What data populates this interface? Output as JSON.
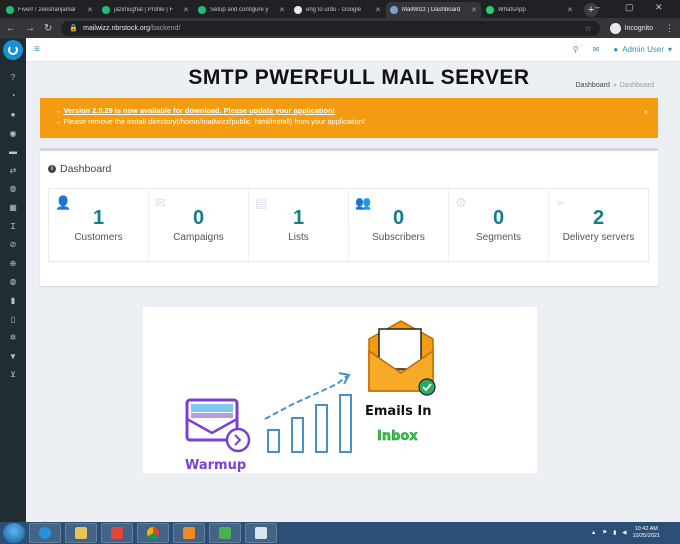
{
  "browser": {
    "tabs": [
      {
        "title": "Fiverr / zeeshanjamal",
        "color": "#1dbf73",
        "active": false
      },
      {
        "title": "jazimughal | Profile | F",
        "color": "#1dbf73",
        "active": false
      },
      {
        "title": "Setup and configure y",
        "color": "#1dbf73",
        "active": false
      },
      {
        "title": "eng to urdu - Google",
        "color": "#e8eaed",
        "active": false
      },
      {
        "title": "MailWizz | Dashboard",
        "color": "#7da0d6",
        "active": true
      },
      {
        "title": "WhatsApp",
        "color": "#25d366",
        "active": false
      }
    ],
    "new_tab": "+",
    "url_host": "mailwizz.nbrstock.org",
    "url_path": "/backend/",
    "incognito_label": "Incognito"
  },
  "topnav": {
    "user_label": "Admin User"
  },
  "page": {
    "title": "SMTP PWERFULL MAIL SERVER",
    "breadcrumb": [
      "Dashboard",
      "Dashboard"
    ]
  },
  "alert": {
    "arrow": "→",
    "version_link": "Version 2.0.29 is now available for download. Please update your application!",
    "line2": "Please remove the install directory(/home/mailwizz/public_html/install) from your application!",
    "close": "×"
  },
  "dashboard": {
    "heading": "Dashboard",
    "stats": [
      {
        "value": "1",
        "label": "Customers",
        "icon": "user-plus-icon"
      },
      {
        "value": "0",
        "label": "Campaigns",
        "icon": "envelope-icon"
      },
      {
        "value": "1",
        "label": "Lists",
        "icon": "list-icon"
      },
      {
        "value": "0",
        "label": "Subscribers",
        "icon": "users-icon"
      },
      {
        "value": "0",
        "label": "Segments",
        "icon": "gear-icon"
      },
      {
        "value": "2",
        "label": "Delivery servers",
        "icon": "paper-plane-icon"
      }
    ]
  },
  "promo": {
    "warmup_label": "Warmup",
    "inbox_line1": "Emails In",
    "inbox_line2": "Inbox",
    "colors": {
      "purple": "#7b3fd6",
      "orange": "#f39c12",
      "blue": "#4a90c8",
      "green": "#27ae60"
    }
  },
  "taskbar": {
    "time": "10:42 AM",
    "date": "10/25/2021"
  },
  "colors": {
    "sidebar": "#222d32",
    "accent": "#3c8dbc",
    "alert": "#f39c12",
    "stat_number": "#127e8b"
  }
}
